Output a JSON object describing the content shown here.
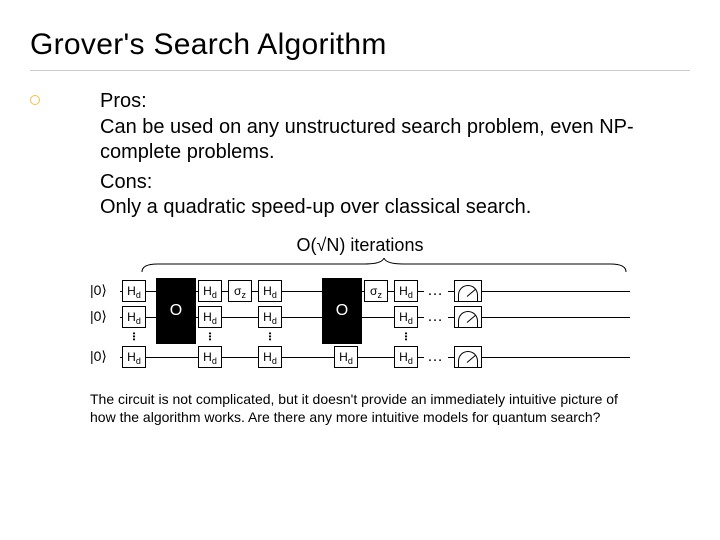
{
  "title": "Grover's Search Algorithm",
  "pros_label": "Pros:",
  "pros_text": "Can be used on any unstructured search problem, even NP-complete problems.",
  "cons_label": "Cons:",
  "cons_text": "Only a quadratic speed-up over classical search.",
  "iter_label": "O(√N) iterations",
  "circuit": {
    "ket0": "|0⟩",
    "Hd": "H",
    "Hd_sub": "d",
    "sigma": "σ",
    "sigma_sub": "z",
    "O": "O",
    "dots": "…"
  },
  "caption": "The circuit is not complicated, but it doesn't provide an immediately intuitive picture of how the algorithm works.  Are there any more intuitive models for quantum search?"
}
